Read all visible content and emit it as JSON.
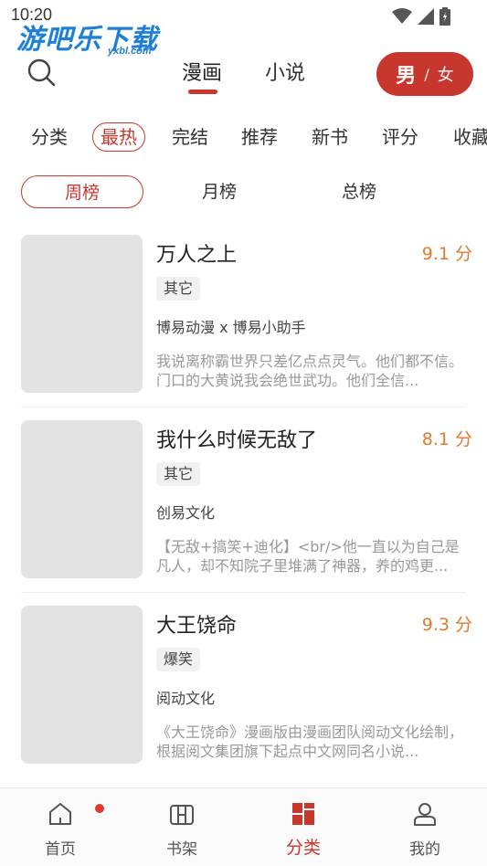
{
  "status_bar": {
    "time": "10:20"
  },
  "watermark": {
    "main": "游吧乐下载",
    "sub": "yxbl.com"
  },
  "header": {
    "tabs": [
      {
        "label": "漫画",
        "active": true
      },
      {
        "label": "小说",
        "active": false
      }
    ],
    "gender": {
      "male": "男",
      "separator": "/",
      "female": "女"
    }
  },
  "categories": [
    "分类",
    "最热",
    "完结",
    "推荐",
    "新书",
    "评分",
    "收藏"
  ],
  "ranks": [
    "周榜",
    "月榜",
    "总榜"
  ],
  "books": [
    {
      "title": "万人之上",
      "score": "9.1 分",
      "tag": "其它",
      "author": "博易动漫 x 博易小助手",
      "desc": "我说离称霸世界只差亿点点灵气。他们都不信。门口的大黄说我会绝世武功。他们全信..."
    },
    {
      "title": "我什么时候无敌了",
      "score": "8.1 分",
      "tag": "其它",
      "author": "创易文化",
      "desc": "【无敌+搞笑+迪化】<br/>他一直以为自己是凡人，却不知院子里堆满了神器，养的鸡更..."
    },
    {
      "title": "大王饶命",
      "score": "9.3 分",
      "tag": "爆笑",
      "author": "阅动文化",
      "desc": "《大王饶命》漫画版由漫画团队阅动文化绘制，根据阅文集团旗下起点中文网同名小说..."
    }
  ],
  "bottom_nav": [
    {
      "label": "首页",
      "icon": "home-icon",
      "badge": true
    },
    {
      "label": "书架",
      "icon": "bookshelf-icon"
    },
    {
      "label": "分类",
      "icon": "category-icon",
      "active": true
    },
    {
      "label": "我的",
      "icon": "profile-icon"
    }
  ],
  "colors": {
    "accent": "#c8372d",
    "score": "#e07a30",
    "cover_placeholder": "#e3e3e3"
  }
}
